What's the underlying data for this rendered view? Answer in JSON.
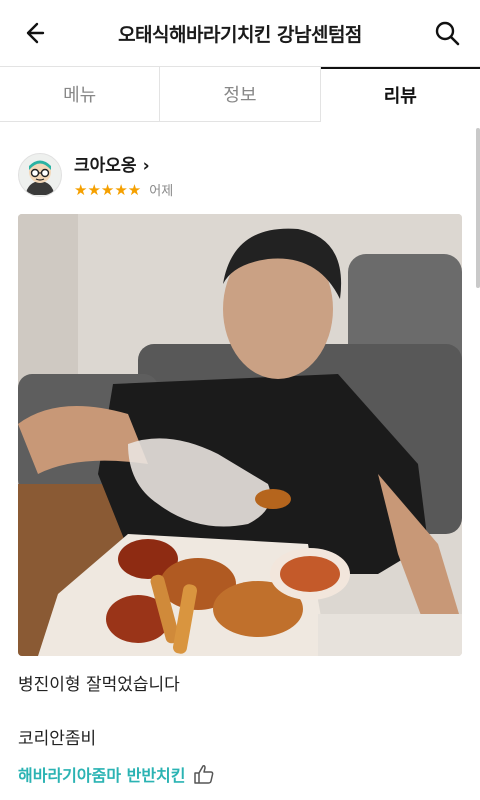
{
  "header": {
    "title": "오태식해바라기치킨 강남센텀점",
    "back_icon": "back-arrow-icon",
    "search_icon": "search-icon"
  },
  "tabs": [
    {
      "label": "메뉴",
      "active": false
    },
    {
      "label": "정보",
      "active": false
    },
    {
      "label": "리뷰",
      "active": true
    }
  ],
  "review": {
    "reviewer_name": "크아오옹",
    "chevron": "›",
    "rating": 5,
    "stars": "★★★★★",
    "date": "어제",
    "text": "병진이형 잘먹었습니다",
    "text2": "코리안좀비",
    "ordered_menu": "해바라기아줌마 반반치킨",
    "like_icon": "thumbs-up-icon",
    "accent_color": "#2bb3b3",
    "star_color": "#f5a000"
  }
}
